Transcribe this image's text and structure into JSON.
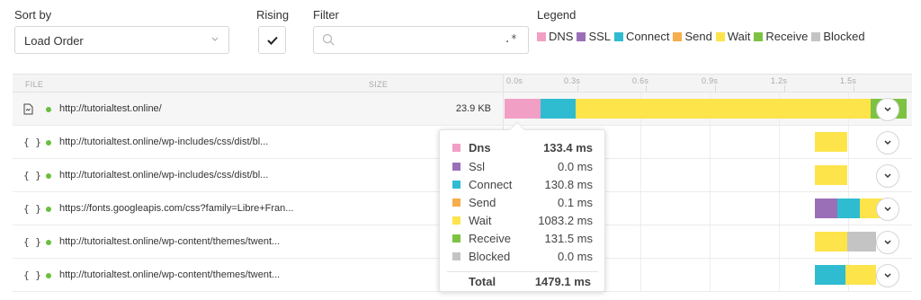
{
  "controls": {
    "sort_label": "Sort by",
    "sort_value": "Load Order",
    "rising_label": "Rising",
    "filter_label": "Filter",
    "filter_value": "",
    "filter_placeholder": "",
    "regex_toggle": ".*",
    "legend_label": "Legend"
  },
  "legend": [
    {
      "label": "DNS",
      "color": "#f29fc5"
    },
    {
      "label": "SSL",
      "color": "#9b6fb8"
    },
    {
      "label": "Connect",
      "color": "#2fbcd0"
    },
    {
      "label": "Send",
      "color": "#f6ad4b"
    },
    {
      "label": "Wait",
      "color": "#fde44b"
    },
    {
      "label": "Receive",
      "color": "#7dc242"
    },
    {
      "label": "Blocked",
      "color": "#c4c4c4"
    }
  ],
  "table": {
    "col_file": "FILE",
    "col_size": "SIZE",
    "timeline_ticks": [
      "0.0s",
      "0.3s",
      "0.6s",
      "0.9s",
      "1.2s",
      "1.5s"
    ],
    "rows": [
      {
        "icon": "html-file-icon",
        "url": "http://tutorialtest.online/",
        "size": "23.9 KB",
        "status_color": "#6abf3c",
        "selected": true
      },
      {
        "icon": "css-file-icon",
        "url": "http://tutorialtest.online/wp-includes/css/dist/bl...",
        "size": "",
        "status_color": "#6abf3c",
        "selected": false
      },
      {
        "icon": "css-file-icon",
        "url": "http://tutorialtest.online/wp-includes/css/dist/bl...",
        "size": "",
        "status_color": "#6abf3c",
        "selected": false
      },
      {
        "icon": "css-file-icon",
        "url": "https://fonts.googleapis.com/css?family=Libre+Fran...",
        "size": "",
        "status_color": "#6abf3c",
        "selected": false
      },
      {
        "icon": "css-file-icon",
        "url": "http://tutorialtest.online/wp-content/themes/twent...",
        "size": "",
        "status_color": "#6abf3c",
        "selected": false
      },
      {
        "icon": "css-file-icon",
        "url": "http://tutorialtest.online/wp-content/themes/twent...",
        "size": "",
        "status_color": "#6abf3c",
        "selected": false
      }
    ]
  },
  "tooltip": {
    "items": [
      {
        "name": "Dns",
        "value": "133.4 ms",
        "color": "#f29fc5",
        "bold": true
      },
      {
        "name": "Ssl",
        "value": "0.0 ms",
        "color": "#9b6fb8",
        "bold": false
      },
      {
        "name": "Connect",
        "value": "130.8 ms",
        "color": "#2fbcd0",
        "bold": false
      },
      {
        "name": "Send",
        "value": "0.1 ms",
        "color": "#f6ad4b",
        "bold": false
      },
      {
        "name": "Wait",
        "value": "1083.2 ms",
        "color": "#fde44b",
        "bold": false
      },
      {
        "name": "Receive",
        "value": "131.5 ms",
        "color": "#7dc242",
        "bold": false
      },
      {
        "name": "Blocked",
        "value": "0.0 ms",
        "color": "#c4c4c4",
        "bold": false
      }
    ],
    "total_label": "Total",
    "total_value": "1479.1 ms"
  }
}
